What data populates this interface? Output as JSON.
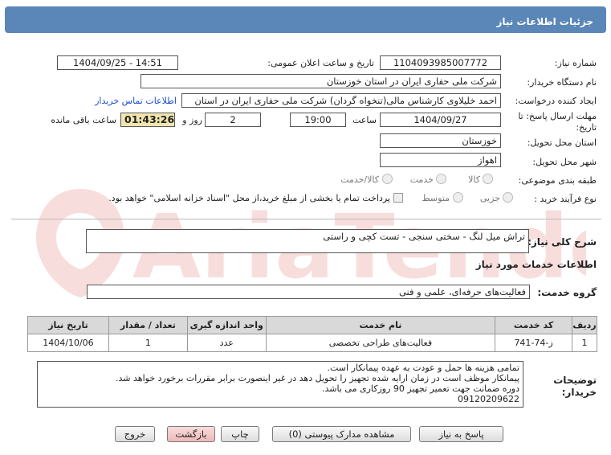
{
  "title": "جزئیات اطلاعات نیاز",
  "fields": {
    "need_number_label": "شماره نیاز:",
    "need_number": "1104093985007772",
    "announce_label": "تاریخ و ساعت اعلان عمومی:",
    "announce_value": "1404/09/25 - 14:51",
    "buyer_org_label": "نام دستگاه خریدار:",
    "buyer_org": "شرکت ملی حفاری ایران در استان خوزستان",
    "creator_label": "ایجاد کننده درخواست:",
    "creator": "احمد خلیلاوی کارشناس مالی(تنخواه گردان) شرکت ملی حفاری ایران در استان",
    "contact_link": "اطلاعات تماس خریدار",
    "deadline_label_1": "مهلت ارسال پاسخ: تا",
    "deadline_label_2": "تاریخ:",
    "deadline_date": "1404/09/27",
    "time_label": "ساعت",
    "deadline_time": "19:00",
    "days_value": "2",
    "days_label": "روز و",
    "remaining_time": "01:43:26",
    "remaining_label": "ساعت باقی مانده",
    "province_label": "استان محل تحویل:",
    "province": "خوزستان",
    "city_label": "شهر محل تحویل:",
    "city": "اهواز",
    "category_label": "طبقه بندی موضوعی:",
    "category_options": [
      "کالا",
      "خدمت",
      "کالا/خدمت"
    ],
    "process_label": "نوع فرآیند خرید :",
    "process_options": [
      "جزیی",
      "متوسط"
    ],
    "process_note": "پرداخت تمام یا بخشی از مبلغ خرید،از محل \"اسناد خزانه اسلامی\" خواهد بود."
  },
  "summary": {
    "label": "شرح کلی نیاز:",
    "value": "تراش میل لنگ - سختی سنجی - تست کچی و راستی"
  },
  "services_header": "اطلاعات خدمات مورد نیاز",
  "service_group": {
    "label": "گروه خدمت:",
    "value": "فعالیت‌های حرفه‌ای، علمی و فنی"
  },
  "table": {
    "headers": [
      "ردیف",
      "کد خدمت",
      "نام خدمت",
      "واحد اندازه گیری",
      "تعداد / مقدار",
      "تاریخ نیاز"
    ],
    "rows": [
      [
        "1",
        "ز-74-741",
        "فعالیت‌های طراحی تخصصی",
        "عدد",
        "1",
        "1404/10/06"
      ]
    ]
  },
  "notes": {
    "label_1": "توضیحات",
    "label_2": "خریدار:",
    "lines": [
      "تمامی هزینه ها حمل و عودت به عهده پیمانکار است.",
      "پیمانکار موظف است در زمان ارایه شده تجهیز را تحویل دهد در غیر اینصورت برابر مقررات برخورد خواهد شد.",
      "دوره ضمانت جهت تعمیر تجهیز  90 روزکاری می باشد.",
      "09120209622"
    ]
  },
  "buttons": {
    "reply": "پاسخ به نیاز",
    "attachments": "مشاهده مدارک پیوستی (0)",
    "print": "چاپ",
    "back": "بازگشت",
    "exit": "خروج"
  },
  "watermark": "AriaTender.net",
  "colors": {
    "titlebar": "#5a86b8",
    "highlight": "#f1e6ae",
    "link": "#1a4fd0",
    "back_button": "#f4c9c9"
  }
}
